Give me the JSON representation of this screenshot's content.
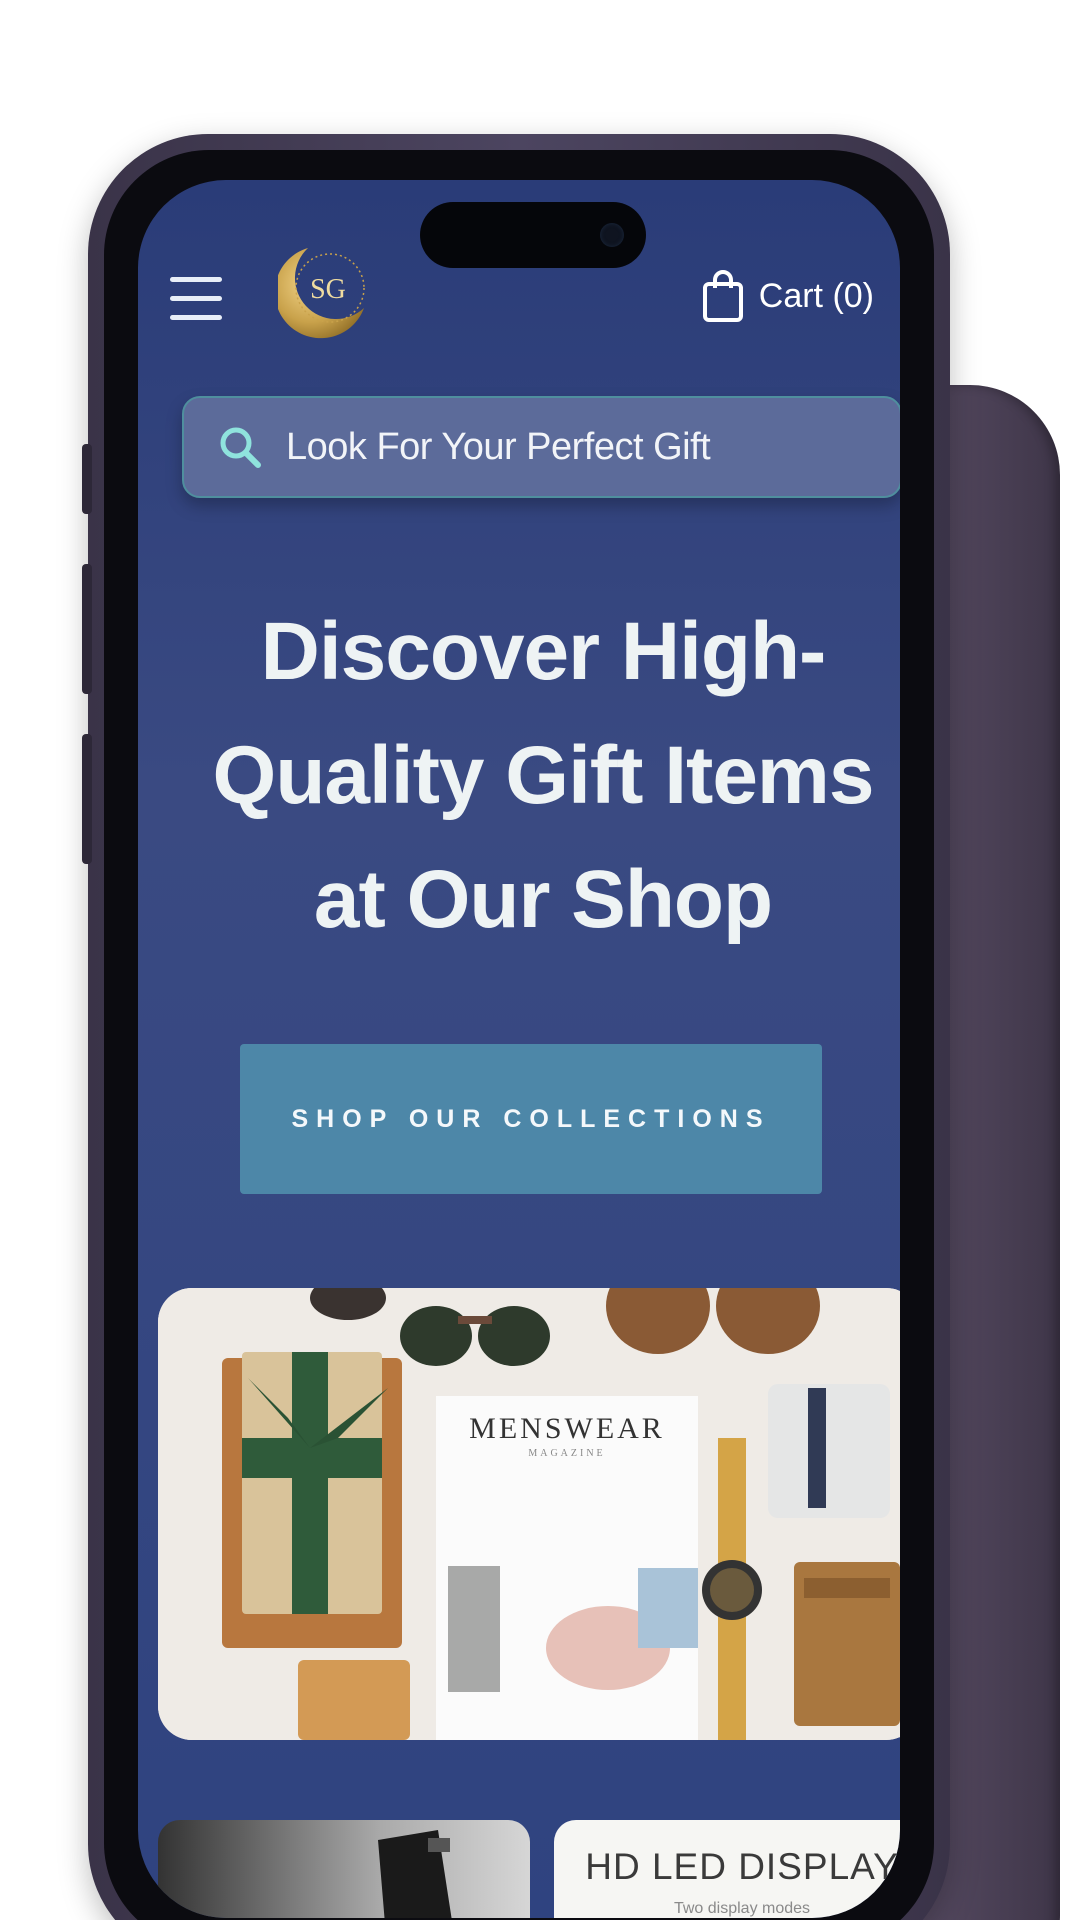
{
  "header": {
    "logo_monogram": "SG",
    "cart_label": "Cart (0)"
  },
  "search": {
    "placeholder": "Look For Your Perfect Gift"
  },
  "hero": {
    "title": "Discover High-Quality Gift Items at Our Shop",
    "cta_label": "SHOP OUR COLLECTIONS"
  },
  "hero_image": {
    "magazine_title": "MENSWEAR",
    "magazine_subtitle": "MAGAZINE"
  },
  "cards": {
    "right_title": "HD LED DISPLAY",
    "right_subtitle": "Two display modes"
  },
  "colors": {
    "screen_bg": "#2f4380",
    "search_bg": "#5c6b9a",
    "search_border": "#4f8f9e",
    "cta_bg": "#4d87a8",
    "hero_text": "#eef3f4",
    "logo_gold": "#c9a24b"
  },
  "icons": {
    "menu": "hamburger-menu-icon",
    "cart": "shopping-bag-icon",
    "search": "search-icon"
  }
}
